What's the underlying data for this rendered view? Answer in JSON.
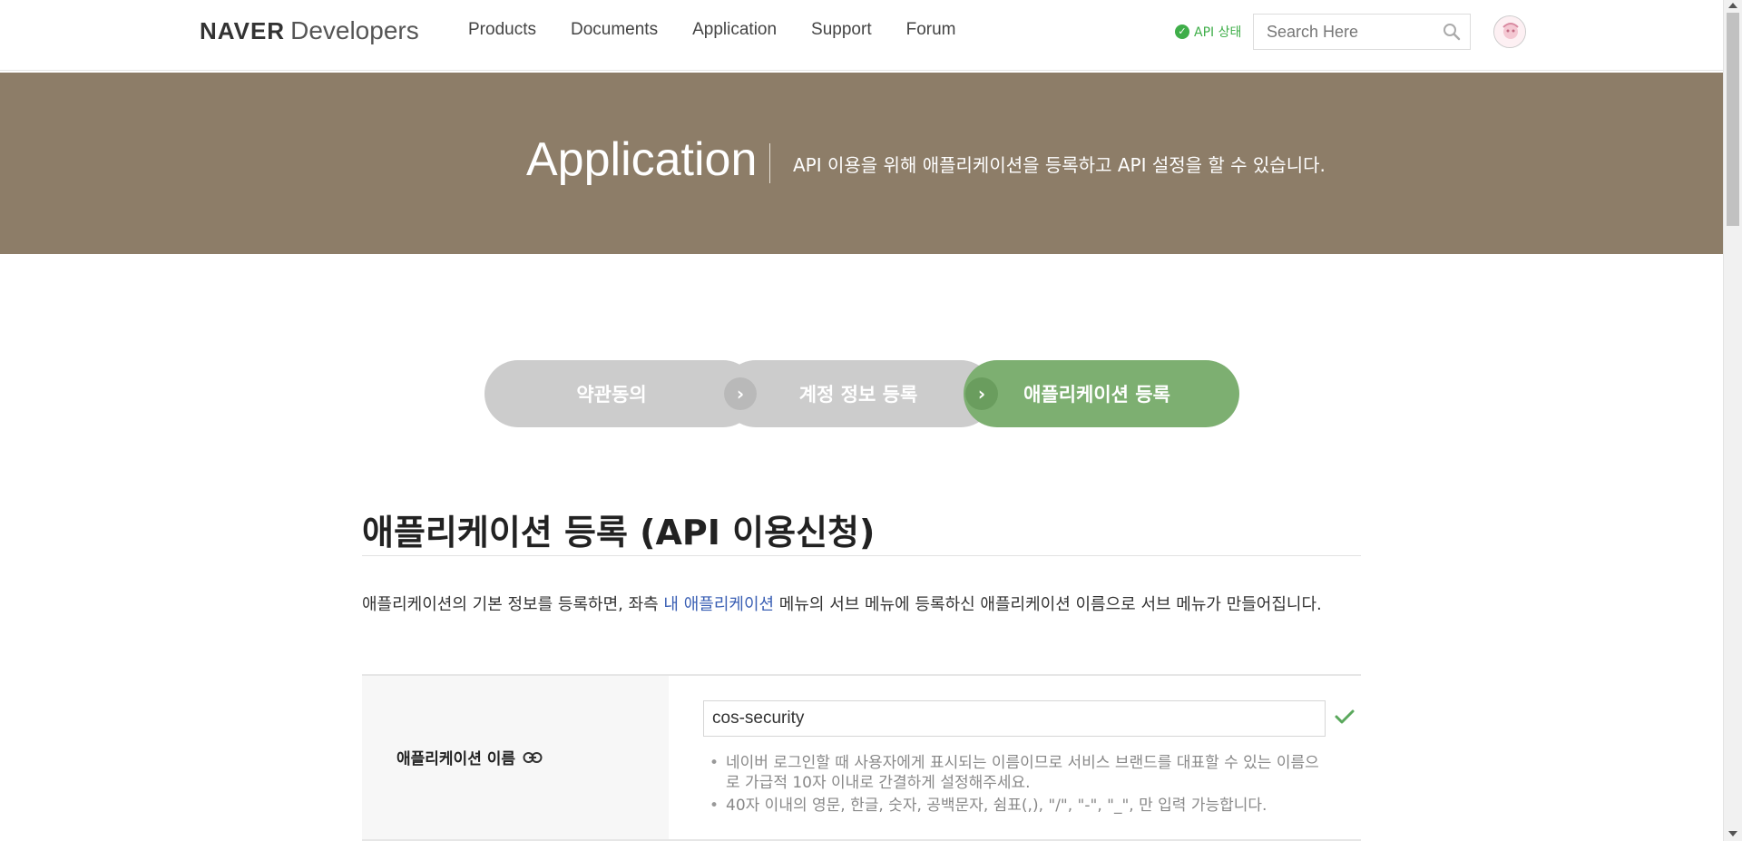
{
  "header": {
    "logo_brand": "NAVER",
    "logo_product": "Developers",
    "nav": [
      {
        "label": "Products"
      },
      {
        "label": "Documents"
      },
      {
        "label": "Application"
      },
      {
        "label": "Support"
      },
      {
        "label": "Forum"
      }
    ],
    "api_status_label": "API 상태",
    "search_placeholder": "Search Here"
  },
  "banner": {
    "title": "Application",
    "subtitle": "API 이용을 위해 애플리케이션을 등록하고 API 설정을 할 수 있습니다."
  },
  "steps": [
    {
      "label": "약관동의"
    },
    {
      "label": "계정 정보 등록"
    },
    {
      "label": "애플리케이션 등록"
    }
  ],
  "section": {
    "title": "애플리케이션 등록 (API 이용신청)",
    "desc_before": "애플리케이션의 기본 정보를 등록하면, 좌측 ",
    "desc_link": "내 애플리케이션",
    "desc_after": " 메뉴의 서브 메뉴에 등록하신 애플리케이션 이름으로 서브 메뉴가 만들어집니다."
  },
  "form": {
    "app_name_label": "애플리케이션 이름",
    "app_name_value": "cos-security",
    "hints": [
      "네이버 로그인할 때 사용자에게 표시되는 이름이므로 서비스 브랜드를 대표할 수 있는 이름으로 가급적 10자 이내로 간결하게 설정해주세요.",
      "40자 이내의 영문, 한글, 숫자, 공백문자, 쉼표(,), \"/\", \"-\", \"_\", 만 입력 가능합니다."
    ]
  },
  "colors": {
    "banner_bg": "#8d7d68",
    "step_active": "#7daf71",
    "step_inactive": "#cccccc",
    "link": "#3a5fb4",
    "status_green": "#3fae49"
  }
}
